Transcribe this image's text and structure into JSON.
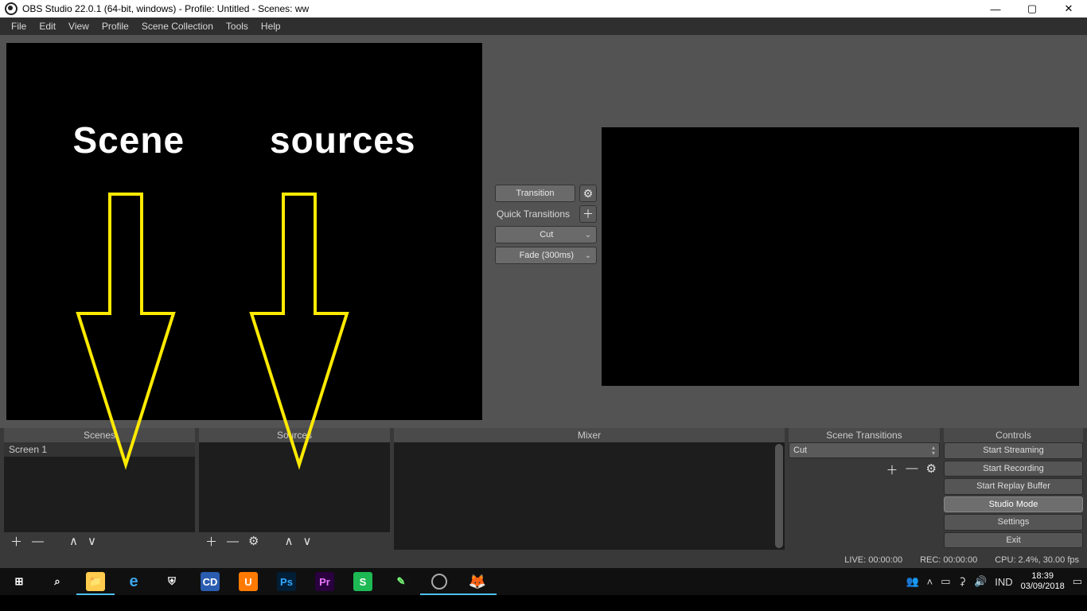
{
  "titlebar": {
    "text": "OBS Studio 22.0.1 (64-bit, windows) - Profile: Untitled - Scenes: ww"
  },
  "menu": {
    "items": [
      "File",
      "Edit",
      "View",
      "Profile",
      "Scene Collection",
      "Tools",
      "Help"
    ]
  },
  "annotation": {
    "left": "Scene",
    "right": "sources"
  },
  "transition": {
    "button": "Transition",
    "quick_label": "Quick Transitions",
    "options": [
      "Cut",
      "Fade (300ms)"
    ]
  },
  "panels": {
    "scenes": {
      "title": "Scenes",
      "items": [
        "Screen 1"
      ]
    },
    "sources": {
      "title": "Sources"
    },
    "mixer": {
      "title": "Mixer"
    },
    "scene_transitions": {
      "title": "Scene Transitions",
      "selected": "Cut"
    },
    "controls": {
      "title": "Controls",
      "buttons": [
        "Start Streaming",
        "Start Recording",
        "Start Replay Buffer",
        "Studio Mode",
        "Settings",
        "Exit"
      ],
      "active_index": 3
    }
  },
  "status": {
    "live": "LIVE: 00:00:00",
    "rec": "REC: 00:00:00",
    "cpu": "CPU: 2.4%, 30.00 fps"
  },
  "taskbar": {
    "lang": "IND",
    "time": "18:39",
    "date": "03/09/2018"
  }
}
